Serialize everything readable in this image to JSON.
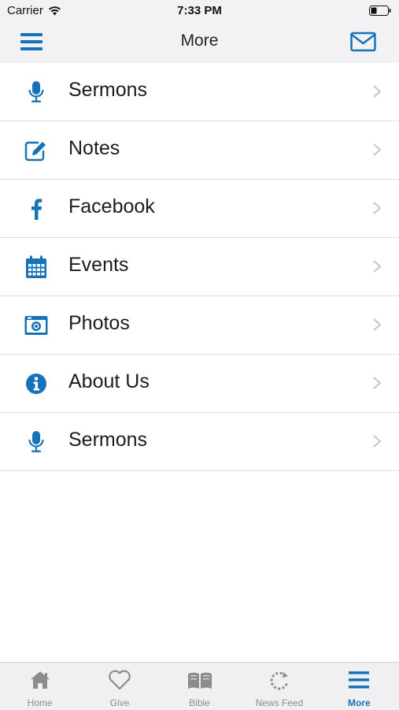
{
  "status_bar": {
    "carrier": "Carrier",
    "time": "7:33 PM",
    "icons": [
      "wifi-icon",
      "battery-icon"
    ]
  },
  "navbar": {
    "title": "More",
    "left_icon": "hamburger-menu-icon",
    "right_icon": "mail-icon"
  },
  "menu_items": [
    {
      "label": "Sermons",
      "icon": "microphone-icon"
    },
    {
      "label": "Notes",
      "icon": "edit-note-icon"
    },
    {
      "label": "Facebook",
      "icon": "facebook-icon"
    },
    {
      "label": "Events",
      "icon": "calendar-icon"
    },
    {
      "label": "Photos",
      "icon": "camera-icon"
    },
    {
      "label": "About Us",
      "icon": "info-icon"
    },
    {
      "label": "Sermons",
      "icon": "microphone-icon"
    }
  ],
  "tab_bar": {
    "tabs": [
      {
        "label": "Home",
        "icon": "home-icon",
        "active": false
      },
      {
        "label": "Give",
        "icon": "heart-icon",
        "active": false
      },
      {
        "label": "Bible",
        "icon": "book-icon",
        "active": false
      },
      {
        "label": "News Feed",
        "icon": "refresh-icon",
        "active": false
      },
      {
        "label": "More",
        "icon": "hamburger-menu-icon",
        "active": true
      }
    ]
  },
  "colors": {
    "accent": "#1673b8",
    "inactive": "#8c8c8c",
    "separator": "#dcdcdc",
    "bar_background": "#f2f2f4"
  }
}
